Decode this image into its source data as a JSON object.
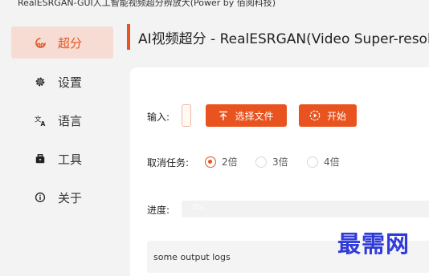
{
  "window": {
    "title": "RealESRGAN-GUI人工智能视频超分辨放大(Power by 佰阅科技)"
  },
  "sidebar": {
    "items": [
      {
        "label": "超分",
        "icon": "sr-icon",
        "active": true
      },
      {
        "label": "设置",
        "icon": "gear-icon",
        "active": false
      },
      {
        "label": "语言",
        "icon": "translate-icon",
        "active": false
      },
      {
        "label": "工具",
        "icon": "toolbox-icon",
        "active": false
      },
      {
        "label": "关于",
        "icon": "info-icon",
        "active": false
      }
    ]
  },
  "header": {
    "title": "AI视频超分 - RealESRGAN(Video Super-resolu"
  },
  "form": {
    "input_label": "输入:",
    "input_value": "",
    "select_file_label": "选择文件",
    "start_label": "开始",
    "scale_label": "取消任务:",
    "scale_options": [
      "2倍",
      "3倍",
      "4倍"
    ],
    "scale_selected": "2倍",
    "progress_label": "进度:",
    "progress_text": "0%",
    "progress_value": 0,
    "log_text": "some output logs"
  },
  "watermark": {
    "text": "最需网"
  },
  "colors": {
    "accent": "#e8531f",
    "active_bg": "#f7dcd4",
    "watermark": "#2f3bd8"
  }
}
